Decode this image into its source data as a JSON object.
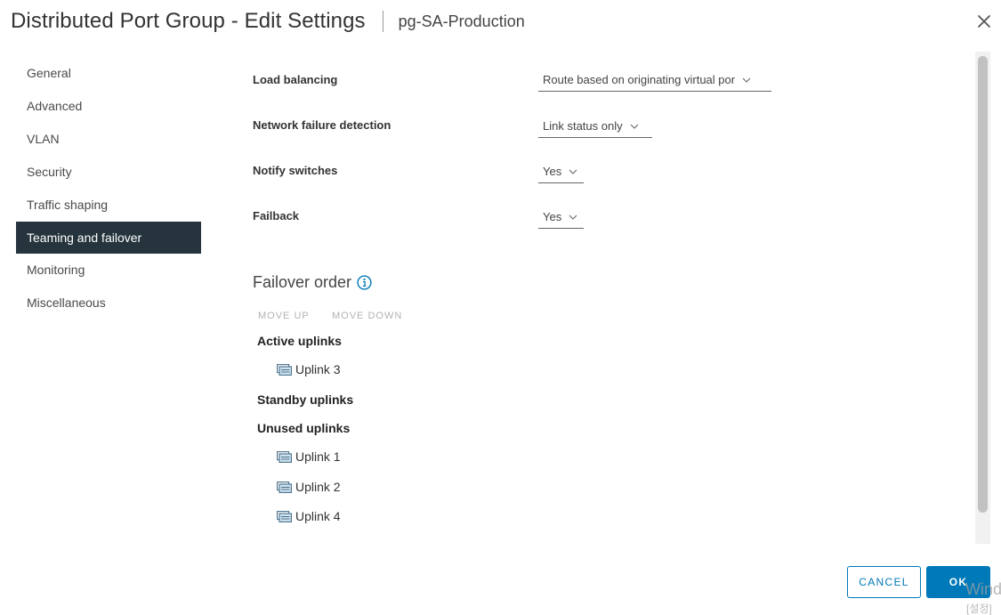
{
  "dialog": {
    "title": "Distributed Port Group - Edit Settings",
    "subtitle": "pg-SA-Production"
  },
  "nav": {
    "items": [
      {
        "label": "General"
      },
      {
        "label": "Advanced"
      },
      {
        "label": "VLAN"
      },
      {
        "label": "Security"
      },
      {
        "label": "Traffic shaping"
      },
      {
        "label": "Teaming and failover",
        "active": true
      },
      {
        "label": "Monitoring"
      },
      {
        "label": "Miscellaneous"
      }
    ]
  },
  "form": {
    "load_balancing": {
      "label": "Load balancing",
      "value": "Route based on originating virtual por"
    },
    "network_failure_detection": {
      "label": "Network failure detection",
      "value": "Link status only"
    },
    "notify_switches": {
      "label": "Notify switches",
      "value": "Yes"
    },
    "failback": {
      "label": "Failback",
      "value": "Yes"
    }
  },
  "failover": {
    "title": "Failover order",
    "move_up": "MOVE UP",
    "move_down": "MOVE DOWN",
    "active_label": "Active uplinks",
    "active": [
      "Uplink 3"
    ],
    "standby_label": "Standby uplinks",
    "standby": [],
    "unused_label": "Unused uplinks",
    "unused": [
      "Uplink 1",
      "Uplink 2",
      "Uplink 4"
    ]
  },
  "footer": {
    "cancel_label": "CANCEL",
    "ok_label": "OK"
  },
  "watermark": {
    "line1": "Wind",
    "line2": "[설정]"
  },
  "colors": {
    "accent": "#0079b8",
    "nav_active_bg": "#25343d",
    "info_icon": "#0079b8"
  }
}
